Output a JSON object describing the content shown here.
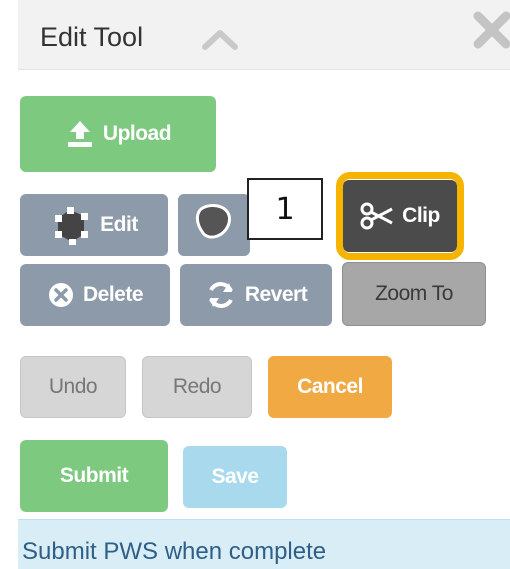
{
  "panel": {
    "title": "Edit Tool",
    "collapse_icon": "chevron-up-icon",
    "close_icon": "close-icon"
  },
  "buttons": {
    "upload": "Upload",
    "edit": "Edit",
    "clip": "Clip",
    "delete": "Delete",
    "revert": "Revert",
    "zoom_to": "Zoom To",
    "undo": "Undo",
    "redo": "Redo",
    "cancel": "Cancel",
    "submit": "Submit",
    "save": "Save"
  },
  "icons": {
    "upload": "upload-icon",
    "edit": "edit-polygon-icon",
    "shape": "draw-shape-icon",
    "clip": "scissors-icon",
    "delete": "delete-circle-icon",
    "revert": "refresh-icon"
  },
  "callout": {
    "label": "1"
  },
  "status": {
    "message": "Submit PWS when complete"
  },
  "colors": {
    "green": "#7dc97f",
    "slate": "#8d9aa9",
    "orange": "#f0a943",
    "light_blue": "#a9d9ec",
    "highlight": "#f6b300",
    "dark": "#4b4b4b",
    "status_bg": "#d9edf7"
  }
}
